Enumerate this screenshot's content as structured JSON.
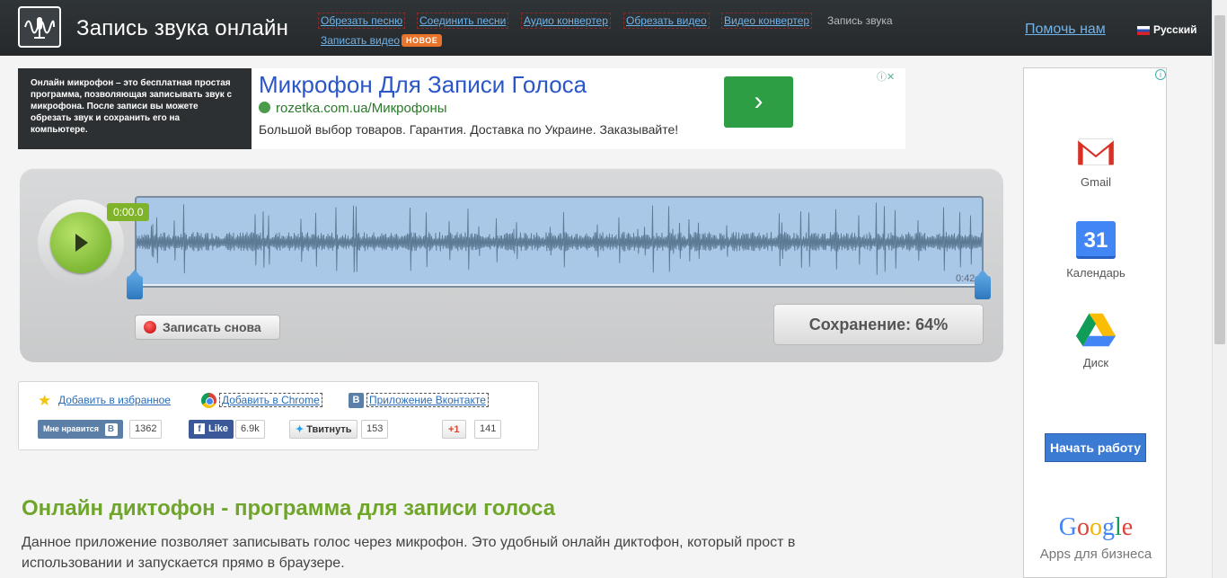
{
  "header": {
    "title": "Запись звука онлайн",
    "nav": [
      {
        "label": "Обрезать песню"
      },
      {
        "label": "Соединить песни"
      },
      {
        "label": "Аудио конвертер"
      },
      {
        "label": "Обрезать видео"
      },
      {
        "label": "Видео конвертер"
      },
      {
        "label": "Запись звука"
      },
      {
        "label": "Записать видео"
      }
    ],
    "new_badge": "НОВОЕ",
    "help": "Помочь нам",
    "language": "Русский"
  },
  "ad_banner": {
    "intro": "Онлайн микрофон – это бесплатная простая программа, позволяющая записывать звук с микрофона. После записи вы можете обрезать звук и сохранить его на компьютере.",
    "title": "Микрофон Для Записи Голоса",
    "url": "rozetka.com.ua/Микрофоны",
    "description": "Большой выбор товаров. Гарантия. Доставка по Украине. Заказывайте!",
    "go_symbol": "›",
    "close_symbol": "ⓘ✕"
  },
  "recorder": {
    "time_start": "0:00.0",
    "time_end": "0:42",
    "record_again": "Записать снова",
    "save_status": "Сохранение: 64%",
    "save_progress": 0.64
  },
  "social": {
    "favorites": "Добавить в избранное",
    "chrome": "Добавить в Chrome",
    "vk_app": "Приложение Вконтакте",
    "vk_like": "Мне нравится",
    "vk_icon": "В",
    "vk_count": "1362",
    "fb_like": "Like",
    "fb_count": "6.9k",
    "tweet": "Твитнуть",
    "tweet_count": "153",
    "gplus": "+1",
    "gplus_count": "141"
  },
  "main": {
    "heading": "Онлайн диктофон - программа для записи голоса",
    "lead": "Данное приложение позволяет записывать голос через микрофон. Это удобный онлайн диктофон, который прост в использовании и запускается прямо в браузере."
  },
  "side_ad": {
    "gmail": "Gmail",
    "calendar": "Календарь",
    "calendar_day": "31",
    "drive": "Диск",
    "start": "Начать работу",
    "google": "Google",
    "apps": "Apps для бизнеса",
    "info": "i"
  }
}
